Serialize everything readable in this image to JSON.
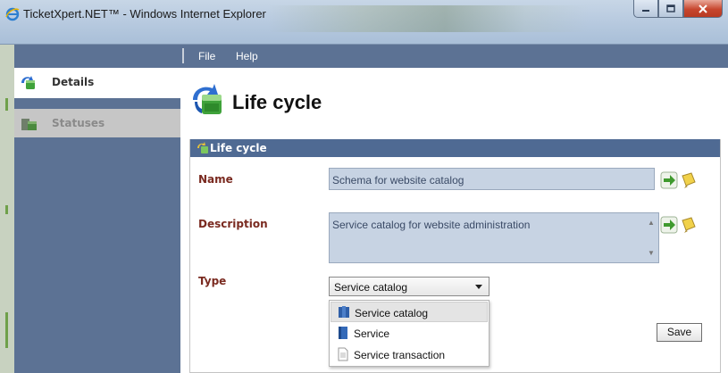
{
  "window": {
    "title": "TicketXpert.NET™ - Windows Internet Explorer",
    "accent": "#5c7294"
  },
  "menu": {
    "items": [
      "File",
      "Help"
    ]
  },
  "sidebar": {
    "items": [
      {
        "label": "Details",
        "icon": "lifecycle-icon",
        "active": true
      },
      {
        "label": "Statuses",
        "icon": "folder-icon",
        "active": false
      }
    ]
  },
  "page": {
    "title": "Life cycle",
    "icon": "lifecycle-icon"
  },
  "panel": {
    "title": "Life cycle",
    "header_color": "#4f6a93"
  },
  "form": {
    "name_label": "Name",
    "name_value": "Schema for website catalog",
    "description_label": "Description",
    "description_value": "Service catalog for website administration",
    "type_label": "Type",
    "type_value": "Service catalog",
    "type_options": [
      {
        "label": "Service catalog",
        "icon": "catalog-icon",
        "highlighted": true
      },
      {
        "label": "Service",
        "icon": "book-icon",
        "highlighted": false
      },
      {
        "label": "Service transaction",
        "icon": "document-icon",
        "highlighted": false
      }
    ],
    "save_label": "Save"
  }
}
